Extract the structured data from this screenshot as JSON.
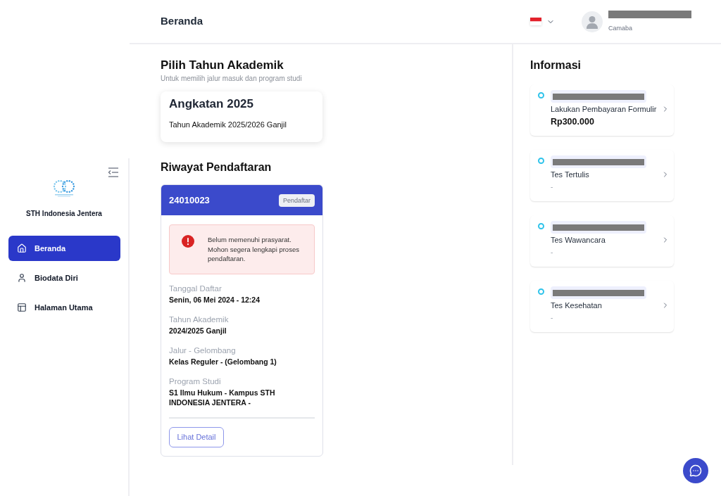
{
  "header": {
    "title": "Beranda",
    "user_role": "Camaba"
  },
  "sidebar": {
    "org_name": "STH Indonesia Jentera",
    "items": [
      {
        "label": "Beranda",
        "kind": "home",
        "selected": true
      },
      {
        "label": "Biodata Diri",
        "kind": "user",
        "selected": false
      },
      {
        "label": "Halaman Utama",
        "kind": "layout",
        "selected": false
      }
    ]
  },
  "academic_year": {
    "title": "Pilih Tahun Akademik",
    "subtitle": "Untuk memilih jalur masuk dan program studi",
    "card": {
      "title": "Angkatan 2025",
      "description": "Tahun Akademik 2025/2026 Ganjil"
    }
  },
  "history": {
    "title": "Riwayat Pendaftaran",
    "registration": {
      "number": "24010023",
      "badge": "Pendaftar",
      "alert": "Belum memenuhi prasyarat. Mohon segera lengkapi proses pendaftaran.",
      "fields": [
        {
          "label": "Tanggal Daftar",
          "value": "Senin, 06 Mei 2024 - 12:24"
        },
        {
          "label": "Tahun Akademik",
          "value": "2024/2025 Ganjil"
        },
        {
          "label": "Jalur - Gelombang",
          "value": "Kelas Reguler - (Gelombang 1)"
        },
        {
          "label": "Program Studi",
          "value": "S1 Ilmu Hukum - Kampus STH INDONESIA JENTERA -"
        }
      ],
      "button": "Lihat Detail"
    }
  },
  "information": {
    "title": "Informasi",
    "items": [
      {
        "title": "Lakukan Pembayaran Formulir",
        "detail": "Rp300.000",
        "kind": "amount"
      },
      {
        "title": "Tes Tertulis",
        "detail": "-",
        "kind": "text"
      },
      {
        "title": "Tes Wawancara",
        "detail": "-",
        "kind": "text"
      },
      {
        "title": "Tes Kesehatan",
        "detail": "-",
        "kind": "text"
      }
    ]
  }
}
